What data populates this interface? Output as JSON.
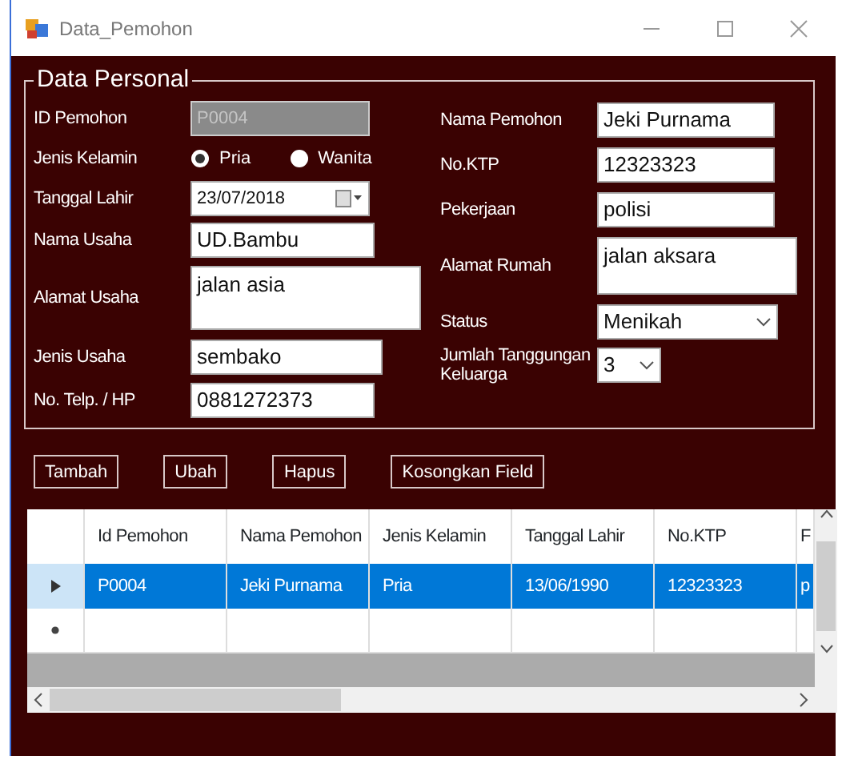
{
  "window": {
    "title": "Data_Pemohon"
  },
  "group": {
    "title": "Data Personal"
  },
  "left_fields": [
    {
      "kind": "readonly",
      "label": "ID Pemohon",
      "value": "P0004"
    },
    {
      "kind": "radio",
      "label": "Jenis Kelamin",
      "options": [
        {
          "label": "Pria",
          "selected": true
        },
        {
          "label": "Wanita",
          "selected": false
        }
      ]
    },
    {
      "kind": "date",
      "label": "Tanggal Lahir",
      "value": "23/07/2018"
    },
    {
      "kind": "text",
      "label": "Nama Usaha",
      "value": "UD.Bambu"
    },
    {
      "kind": "textarea",
      "label": "Alamat Usaha",
      "value": "jalan asia"
    },
    {
      "kind": "text",
      "label": "Jenis Usaha",
      "value": "sembako"
    },
    {
      "kind": "text",
      "label": "No. Telp. / HP",
      "value": "0881272373"
    }
  ],
  "right_fields": [
    {
      "kind": "text",
      "label": "Nama Pemohon",
      "value": "Jeki Purnama"
    },
    {
      "kind": "text",
      "label": "No.KTP",
      "value": "12323323"
    },
    {
      "kind": "text",
      "label": "Pekerjaan",
      "value": "polisi"
    },
    {
      "kind": "textarea",
      "label": "Alamat Rumah",
      "value": "jalan aksara"
    },
    {
      "kind": "select",
      "label": "Status",
      "value": "Menikah"
    },
    {
      "kind": "select",
      "label": "Jumlah Tanggungan Keluarga",
      "value": "3"
    }
  ],
  "buttons": [
    "Tambah",
    "Ubah",
    "Hapus",
    "Kosongkan Field"
  ],
  "table": {
    "columns": [
      "Id Pemohon",
      "Nama Pemohon",
      "Jenis Kelamin",
      "Tanggal Lahir",
      "No.KTP",
      "F"
    ],
    "rows": [
      {
        "selected": true,
        "cells": [
          "P0004",
          "Jeki Purnama",
          "Pria",
          "13/06/1990",
          "12323323",
          "p"
        ]
      }
    ]
  }
}
